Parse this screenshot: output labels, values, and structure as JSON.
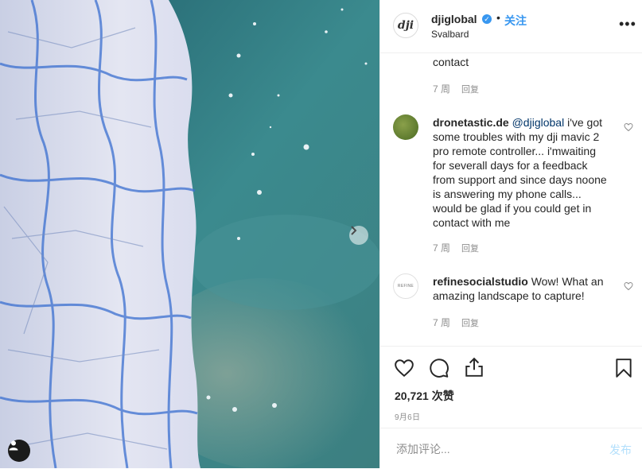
{
  "post": {
    "username": "djiglobal",
    "logo_text": "dji",
    "verified_mark": "✓",
    "dot": "•",
    "follow_label": "关注",
    "location": "Svalbard",
    "more_label": "•••"
  },
  "comments": [
    {
      "text_tail": "contact",
      "time": "7 周",
      "reply": "回复"
    },
    {
      "username": "dronetastic.de",
      "mention": "@djiglobal",
      "text": " i've got some troubles with my dji mavic 2 pro remote controller... i'mwaiting for severall days for a feedback from support and since days noone is answering my phone calls... would be glad if you could get in contact with me",
      "time": "7 周",
      "reply": "回复"
    },
    {
      "username": "refinesocialstudio",
      "text": " Wow! What an amazing landscape to capture!",
      "avatar_text": "REFINE",
      "time": "7 周",
      "reply": "回复"
    }
  ],
  "stats": {
    "likes": "20,721 次赞",
    "date": "9月6日"
  },
  "composer": {
    "placeholder": "添加评论...",
    "post_label": "发布"
  },
  "icons": {
    "like": "heart-outline-icon",
    "comment": "comment-bubble-icon",
    "share": "share-icon",
    "save": "bookmark-icon",
    "next": "chevron-right-icon",
    "tag": "user-tag-icon"
  },
  "colors": {
    "accent": "#3897f0",
    "mention": "#003569",
    "muted": "#8e8e8e"
  }
}
